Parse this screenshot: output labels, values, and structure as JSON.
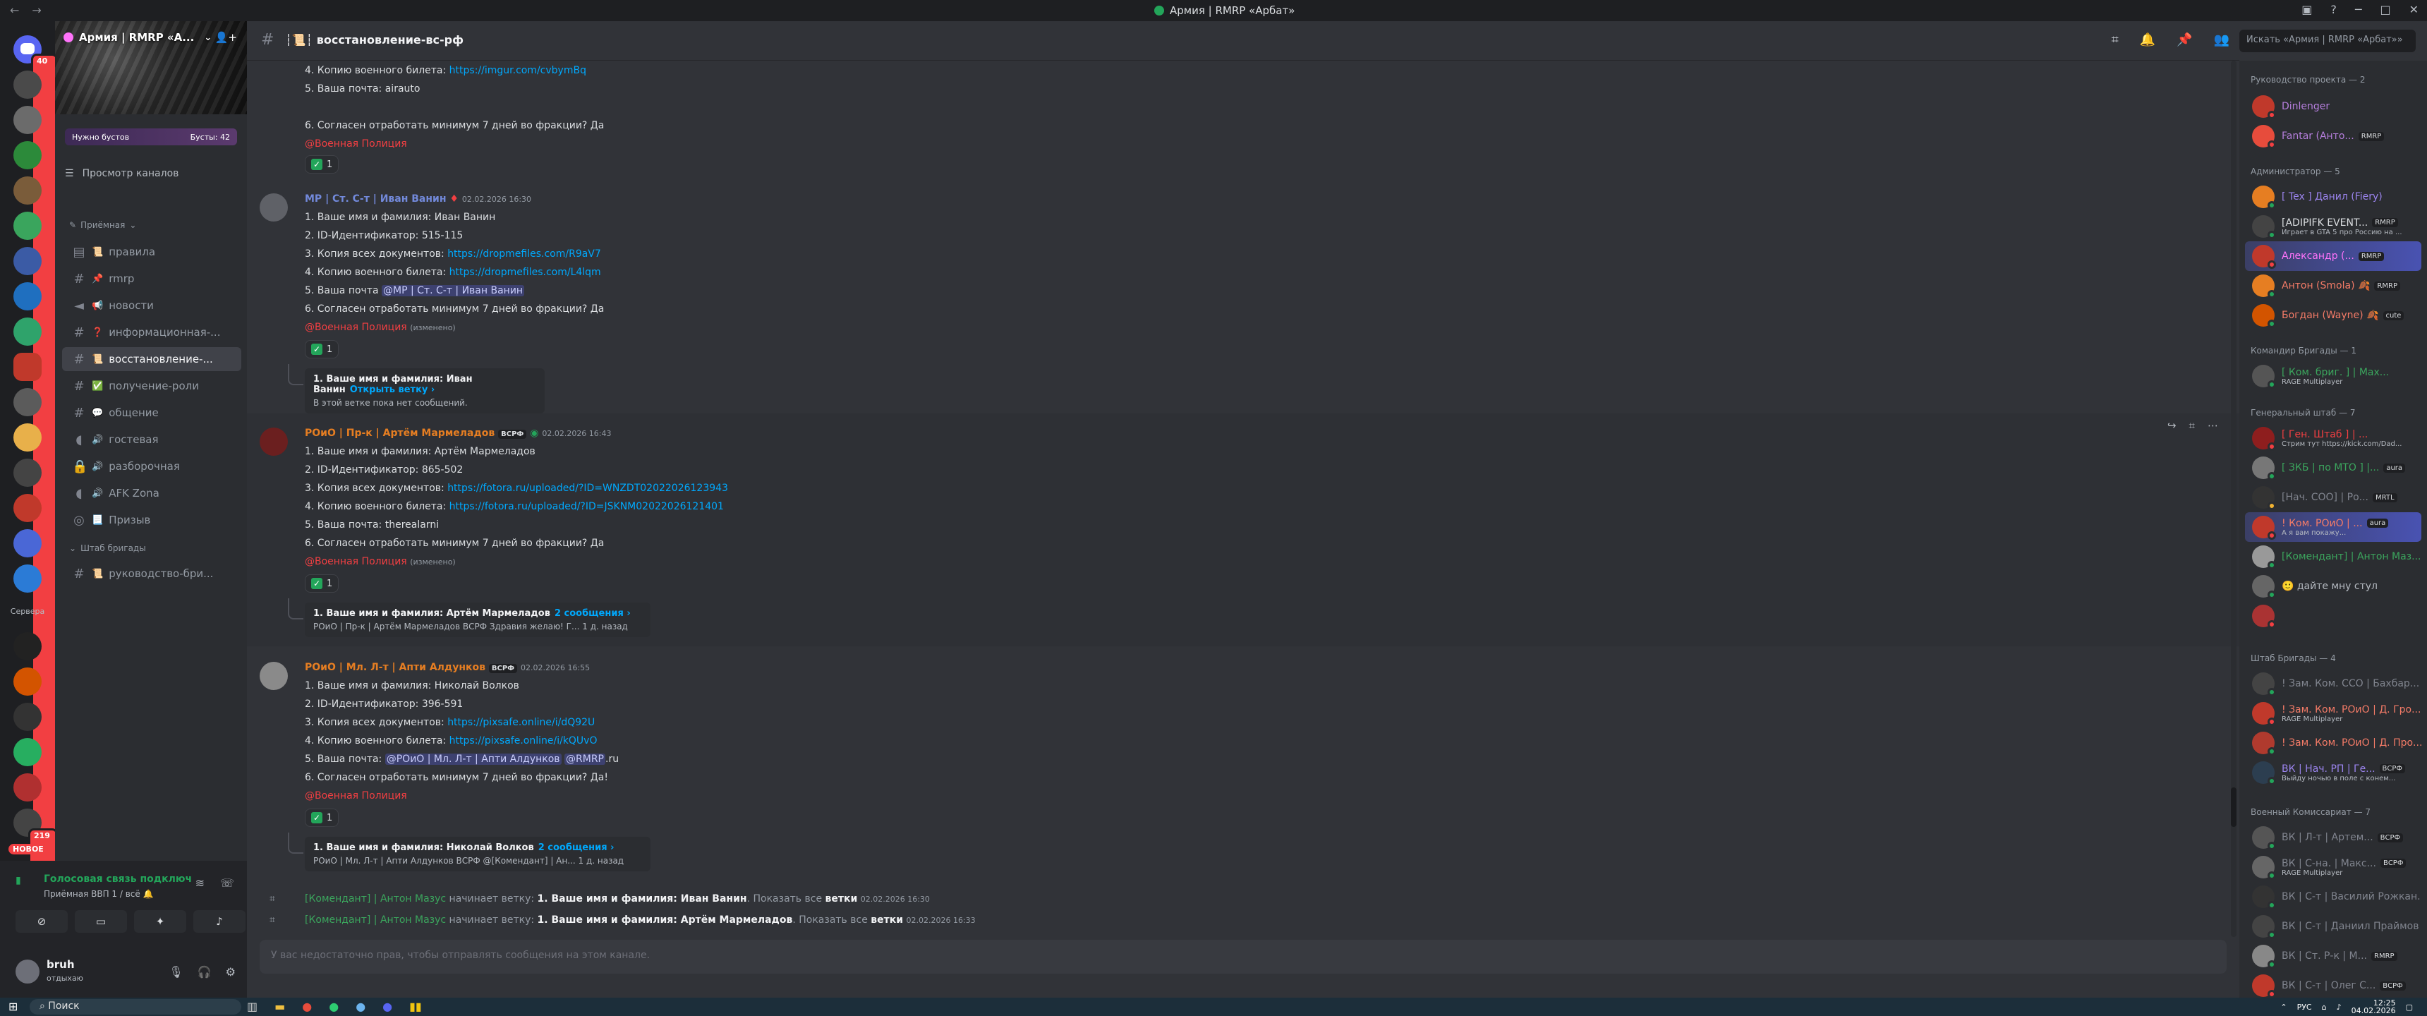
{
  "window": {
    "title": "Армия | RMRP «Арбат»",
    "controls": [
      "─",
      "□",
      "✕"
    ]
  },
  "rail": {
    "badges": {
      "top": "40",
      "second": "219"
    },
    "folder_label": "Сервера",
    "new_label": "НОВОЕ"
  },
  "server": {
    "name": "Армия | RMRP «А...",
    "boost_label": "Нужно бустов",
    "boost_count": "Бусты: 42",
    "browse_label": "Просмотр каналов"
  },
  "categories": [
    {
      "label": "Приёмная"
    },
    {
      "label": "Штаб бригады"
    }
  ],
  "channels": [
    {
      "icon": "rules",
      "emoji": "📜",
      "name": "правила"
    },
    {
      "icon": "hash",
      "emoji": "📌",
      "name": "rmrp"
    },
    {
      "icon": "announce",
      "emoji": "📢",
      "name": "новости"
    },
    {
      "icon": "hash",
      "emoji": "❓",
      "name": "информационная-..."
    },
    {
      "icon": "hash",
      "emoji": "📜",
      "name": "восстановление-..."
    },
    {
      "icon": "hash",
      "emoji": "✅",
      "name": "получение-роли"
    },
    {
      "icon": "hash",
      "emoji": "💬",
      "name": "общение"
    },
    {
      "icon": "voice",
      "emoji": "🔊",
      "name": "гостевая"
    },
    {
      "icon": "voice-lock",
      "emoji": "🔊",
      "name": "разборочная"
    },
    {
      "icon": "voice",
      "emoji": "🔊",
      "name": "AFK Zona"
    },
    {
      "icon": "stage",
      "emoji": "📃",
      "name": "Призыв"
    },
    {
      "icon": "hash",
      "emoji": "📜",
      "name": "руководство-бри..."
    }
  ],
  "voice": {
    "status": "Голосовая связь подключ",
    "sub": "Приёмная ВВП 1 / всё 🔔"
  },
  "user": {
    "name": "bruh",
    "status": "отдыхаю"
  },
  "channel": {
    "name": "┆📜┆ восстановление-вс-рф",
    "composer_placeholder": "У вас недостаточно прав, чтобы отправлять сообщения на этом канале."
  },
  "search_placeholder": "Искать «Армия | RMRP «Арбат»»",
  "messages": {
    "m0": {
      "l1_text": "4. Копию военного билета: ",
      "l1_link": "https://imgur.com/cvbymBq",
      "l2": "5. Ваша почта: airauto",
      "l3": "6. Согласен отработать минимум 7 дней во фракции? Да",
      "mention": "@Военная Полиция",
      "reaction": "1"
    },
    "m1": {
      "author": "МР | Ст. С-т | Иван Ванин",
      "ts": "02.02.2026 16:30",
      "l1": "1. Ваше имя и фамилия: Иван Ванин",
      "l2": "2. ID-Идентификатор: 515-115",
      "l3_text": "3. Копия всех документов: ",
      "l3_link": "https://dropmefiles.com/R9aV7",
      "l4_text": "4. Копию военного билета: ",
      "l4_link": "https://dropmefiles.com/L4lqm",
      "l5_text": "5. Ваша почта ",
      "l5_mention": "@МР | Ст. С-т | Иван Ванин",
      "l6": "6. Согласен отработать минимум 7 дней во фракции? Да",
      "mention": "@Военная Полиция",
      "edited": "(изменено)",
      "reaction": "1",
      "thread_title": "1. Ваше имя и фамилия: Иван Ванин",
      "thread_link": "Открыть ветку ›",
      "thread_sub": "В этой ветке пока нет сообщений."
    },
    "m2": {
      "author": "РОиО | Пр-к | Артём Мармеладов",
      "tag": "ВСРФ",
      "ts": "02.02.2026 16:43",
      "l1": "1. Ваше имя и фамилия: Артём Мармеладов",
      "l2": "2. ID-Идентификатор: 865-502",
      "l3_text": "3. Копия всех документов: ",
      "l3_link": "https://fotora.ru/uploaded/?ID=WNZDT02022026123943",
      "l4_text": "4. Копию военного билета: ",
      "l4_link": "https://fotora.ru/uploaded/?ID=JSKNM02022026121401",
      "l5": "5. Ваша почта: therealarni",
      "l6": "6. Согласен отработать минимум 7 дней во фракции? Да",
      "mention": "@Военная Полиция",
      "edited": "(изменено)",
      "reaction": "1",
      "thread_title": "1. Ваше имя и фамилия: Артём Мармеладов",
      "thread_link": "2 сообщения ›",
      "thread_sub": "РОиО | Пр-к | Артём Мармеладов  ВСРФ  Здравия желаю! Г...  1 д. назад"
    },
    "m3": {
      "author": "РОиО | Мл. Л-т | Апти Алдунков",
      "tag": "ВСРФ",
      "ts": "02.02.2026 16:55",
      "l1": "1. Ваше имя и фамилия: Николай Волков",
      "l2": "2. ID-Идентификатор: 396-591",
      "l3_text": "3. Копия всех документов: ",
      "l3_link": "https://pixsafe.online/i/dQ92U",
      "l4_text": "4. Копию военного билета: ",
      "l4_link": "https://pixsafe.online/i/kQUvO",
      "l5_text": "5. Ваша почта: ",
      "l5_mention": "@РОиО | Мл. Л-т | Апти Алдунков",
      "l5_mention2": "@RMRP",
      "l5_tail": ".ru",
      "l6": "6. Согласен отработать минимум 7 дней во фракции? Да!",
      "mention": "@Военная Полиция",
      "reaction": "1",
      "thread_title": "1. Ваше имя и фамилия: Николай Волков",
      "thread_link": "2 сообщения ›",
      "thread_sub": "РОиО | Мл. Л-т | Апти Алдунков  ВСРФ  @[Комендант] | Ан...  1 д. назад"
    },
    "sys1": {
      "name": "[Комендант] | Антон Мазус",
      "verb": " начинает ветку: ",
      "thread": "1. Ваше имя и фамилия: Иван Ванин",
      "show": ". Показать все ",
      "threads": "ветки",
      "ts": "02.02.2026 16:30"
    },
    "sys2": {
      "name": "[Комендант] | Антон Мазус",
      "verb": " начинает ветку: ",
      "thread": "1. Ваше имя и фамилия: Артём Мармеладов",
      "show": ". Показать все ",
      "threads": "ветки",
      "ts": "02.02.2026 16:33"
    }
  },
  "members": {
    "groups": [
      {
        "label": "Руководство проекта — 2"
      },
      {
        "label": "Администратор — 5"
      },
      {
        "label": "Командир Бригады — 1"
      },
      {
        "label": "Генеральный штаб — 7"
      },
      {
        "label": "Штаб Бригады — 4"
      },
      {
        "label": "Военный Комиссариат — 7"
      }
    ],
    "items": [
      {
        "name": "Dinlenger",
        "color": "#b57edc",
        "tag": "",
        "activity": ""
      },
      {
        "name": "Fantar (Анто...",
        "color": "#b57edc",
        "tag": "RMRP",
        "activity": ""
      },
      {
        "name": "[ Tex ] Данил (Fiery)",
        "color": "#9b84ee",
        "tag": "",
        "activity": ""
      },
      {
        "name": "[ADIPIFK EVENT...",
        "color": "#dbdee1",
        "tag": "RMRP",
        "activity": "Играет в GTA 5 про Россию на ..."
      },
      {
        "name": "Александр (...",
        "color": "#ff73fa",
        "tag": "RMRP",
        "activity": ""
      },
      {
        "name": "Антон (Smola) 🍂",
        "color": "#f47b67",
        "tag": "RMRP",
        "activity": ""
      },
      {
        "name": "Богдан (Wayne) 🍂",
        "color": "#f47b67",
        "tag": "cute",
        "activity": ""
      },
      {
        "name": "[ Ком. бриг. ] | Мах...",
        "color": "#3ba55d",
        "tag": "",
        "activity": "RAGE Multiplayer"
      },
      {
        "name": "[ Ген. Штаб ] | ...",
        "color": "#f23f42",
        "tag": "",
        "activity": "Стрим тут https://kick.com/Dad..."
      },
      {
        "name": "[ ЗКБ | по МТО ] |...",
        "color": "#3ba55d",
        "tag": "aura",
        "activity": ""
      },
      {
        "name": "[Нач. СОО] | Ро...",
        "color": "#80848e",
        "tag": "MRTL",
        "activity": ""
      },
      {
        "name": "! Ком. РОиО | ...",
        "color": "#f47b67",
        "tag": "aura",
        "activity": "А я вам покажу..."
      },
      {
        "name": "[Комендант] | Антон Маз...",
        "color": "#3ba55d",
        "tag": "",
        "activity": ""
      },
      {
        "name": "🙂 дайте мну стул",
        "color": "#b5bac1",
        "tag": "",
        "activity": ""
      },
      {
        "name": "",
        "color": "#b5bac1",
        "tag": "",
        "activity": ""
      },
      {
        "name": "! Зам. Ком. ССО | Бахбар...",
        "color": "#80848e",
        "tag": "",
        "activity": ""
      },
      {
        "name": "! Зам. Ком. РОиО | Д. Гро...",
        "color": "#f47b67",
        "tag": "",
        "activity": "RAGE Multiplayer"
      },
      {
        "name": "! Зам. Ком. РОиО | Д. Про...",
        "color": "#f47b67",
        "tag": "",
        "activity": ""
      },
      {
        "name": "ВК | Нач. РП | Ге...",
        "color": "#9b84ee",
        "tag": "ВСРФ",
        "activity": "Выйду ночью в поле с конем..."
      },
      {
        "name": "ВК | Л-т | Артем...",
        "color": "#80848e",
        "tag": "ВСРФ",
        "activity": ""
      },
      {
        "name": "ВК | С-на. | Макс...",
        "color": "#80848e",
        "tag": "ВСРФ",
        "activity": "RAGE Multiplayer"
      },
      {
        "name": "ВК | С-т | Василий Рожкан...",
        "color": "#80848e",
        "tag": "",
        "activity": ""
      },
      {
        "name": "ВК | С-т | Даниил Праймов",
        "color": "#80848e",
        "tag": "",
        "activity": ""
      },
      {
        "name": "ВК | Ст. Р-к | М...",
        "color": "#80848e",
        "tag": "RMRP",
        "activity": ""
      },
      {
        "name": "ВК | С-т | Олег С...",
        "color": "#80848e",
        "tag": "ВСРФ",
        "activity": ""
      }
    ]
  },
  "taskbar": {
    "search": "Поиск",
    "lang": "РУС",
    "time": "12:25",
    "date": "04.02.2026"
  }
}
